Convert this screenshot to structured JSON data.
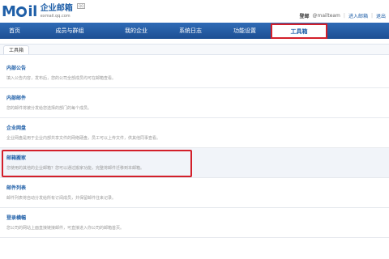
{
  "header": {
    "logo_text": "M",
    "logo_text2": "il",
    "logo_cn": "企业邮箱",
    "logo_url": "exmail.qq.com",
    "logo_badge": "QQ"
  },
  "user": {
    "name": "登邮",
    "address": "@mailteam",
    "switch_label": "进入邮箱",
    "exit_label": "退出"
  },
  "nav": {
    "items": [
      {
        "label": "首页"
      },
      {
        "label": "成员与群组"
      },
      {
        "label": "我的企业"
      },
      {
        "label": "系统日志"
      },
      {
        "label": "功能设置"
      },
      {
        "label": "工具箱"
      }
    ]
  },
  "breadcrumb": {
    "label": "工具箱"
  },
  "tools": [
    {
      "title": "内部公告",
      "desc": "填入公告内容，发布后，您的公司全部成员均可在邮箱查看。"
    },
    {
      "title": "内部邮件",
      "desc": "您的邮件将被分发给您选择的部门的每个成员。"
    },
    {
      "title": "企业网盘",
      "desc": "企业网盘是用于企业内部共享文件的网络硬盘，员工可以上传文件，供其他同事查看。"
    },
    {
      "title": "邮箱搬家",
      "desc": "您使用的其他的企业邮箱？您可以通过搬家功能，完整将邮件迁移到本邮箱。"
    },
    {
      "title": "邮件列表",
      "desc": "邮件列表将自动分发给所有订阅成员，并保留邮件往来记录。"
    },
    {
      "title": "登录横幅",
      "desc": "您公司的网站上面直接链接邮件，可直接进入你公司的邮箱首页。"
    }
  ]
}
